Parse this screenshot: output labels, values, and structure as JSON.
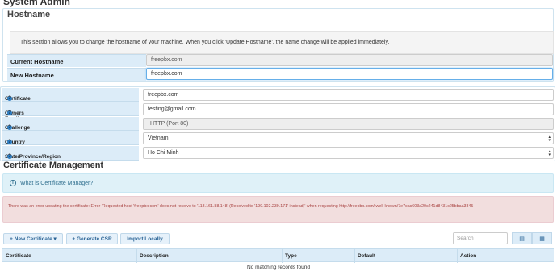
{
  "page_title": "System Admin",
  "hostname": {
    "title": "Hostname",
    "info": "This section allows you to change the hostname of your machine. When you click 'Update Hostname', the name change will be applied immediately.",
    "current_label": "Current Hostname",
    "current_value": "freepbx.com",
    "new_label": "New Hostname",
    "new_value": "freepbx.com"
  },
  "certificate_form": {
    "host_label": "Certificate Host Name",
    "host_value": "freepbx.com",
    "email_label": "Owners Email",
    "email_value": "testing@gmail.com",
    "challenge_label": "Challenge Over",
    "challenge_value": "HTTP (Port 80)",
    "country_label": "Country",
    "country_value": "Vietnam",
    "state_label": "State/Province/Region",
    "state_value": "Ho Chi Minh",
    "help_glyph": "?"
  },
  "cert_management": {
    "title": "Certificate Management",
    "what_is": "What is Certificate Manager?",
    "info_glyph": "i",
    "error": "There was an error updating the certificate: Error 'Requested host 'freepbx.com' does not resolve to '113.161.88.148' (Resolved to '199.102.239.171' instead)' when requesting http://freepbx.com/.well-known/7e7cac603a20c241d8431c25bbaa3845",
    "buttons": {
      "new_certificate": "+ New Certificate ▾",
      "generate_csr": "+ Generate CSR",
      "import_locally": "Import Locally"
    },
    "search_placeholder": "Search",
    "view_icons": [
      "▤",
      "▦"
    ],
    "table": {
      "columns": [
        "Certificate",
        "Description",
        "Type",
        "Default",
        "Action"
      ],
      "empty_message": "No matching records found"
    }
  },
  "colors": {
    "accent": "#2b7cc2",
    "label_bg": "#dcecf8",
    "error_bg": "#f2dede",
    "error_text": "#a94442",
    "info_bg": "#dff1f8",
    "info_text": "#31708f"
  }
}
